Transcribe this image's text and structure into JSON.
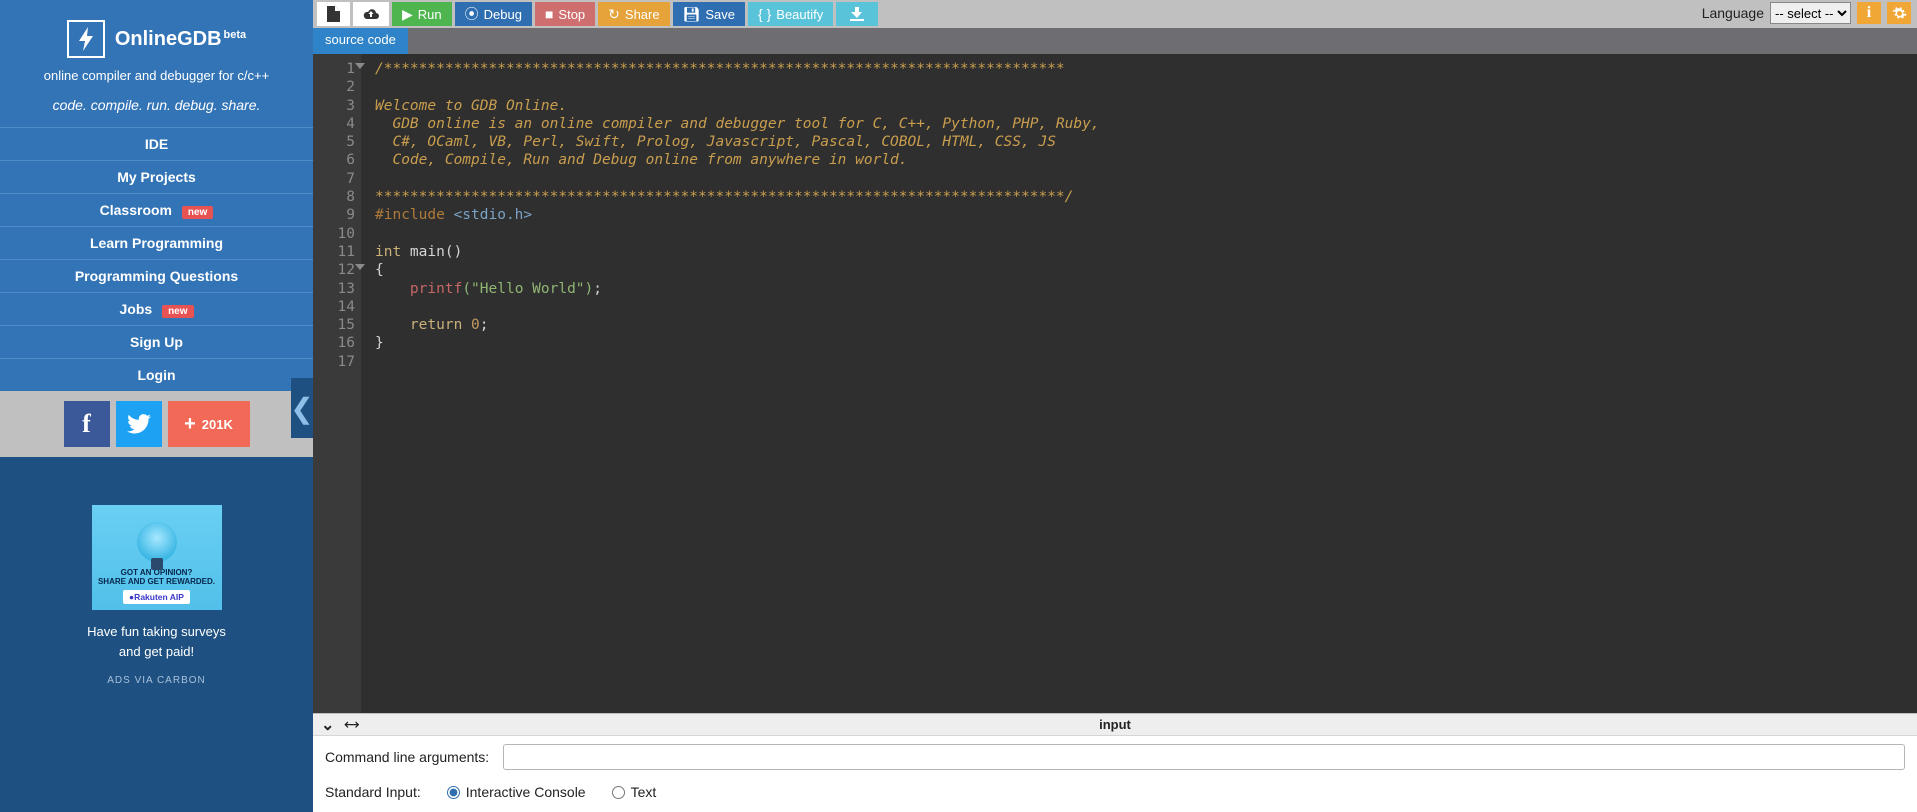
{
  "app": {
    "name": "OnlineGDB",
    "beta": "beta",
    "sub": "online compiler and debugger for c/c++",
    "tag": "code. compile. run. debug. share."
  },
  "nav": {
    "ide": "IDE",
    "projects": "My Projects",
    "classroom": "Classroom",
    "learn": "Learn Programming",
    "questions": "Programming Questions",
    "jobs": "Jobs",
    "signup": "Sign Up",
    "login": "Login",
    "new": "new"
  },
  "social": {
    "share_count": "201K"
  },
  "ad": {
    "line1": "GOT AN OPINION?",
    "line2": "SHARE AND GET REWARDED.",
    "strip": "●Rakuten AIP",
    "caption1": "Have fun taking surveys",
    "caption2": "and get paid!",
    "via": "ADS VIA CARBON"
  },
  "toolbar": {
    "run": "Run",
    "debug": "Debug",
    "stop": "Stop",
    "share": "Share",
    "save": "Save",
    "beautify": "Beautify",
    "language_label": "Language",
    "language_selected": "-- select --"
  },
  "tabs": {
    "source": "source code"
  },
  "code": {
    "lines": {
      "l1": "/******************************************************************************",
      "l2": "",
      "l3": "Welcome to GDB Online.",
      "l4": "  GDB online is an online compiler and debugger tool for C, C++, Python, PHP, Ruby, ",
      "l5": "  C#, OCaml, VB, Perl, Swift, Prolog, Javascript, Pascal, COBOL, HTML, CSS, JS",
      "l6": "  Code, Compile, Run and Debug online from anywhere in world.",
      "l7": "",
      "l8": "*******************************************************************************/",
      "include_kw": "#include ",
      "include_hdr": "<stdio.h>",
      "int": "int",
      "main_sig": " main()",
      "brace_open": "{",
      "printf": "printf",
      "printf_arg": "(\"Hello World\")",
      "semi": ";",
      "return_kw": "return",
      "zero": "0",
      "brace_close": "}"
    }
  },
  "bottom": {
    "title": "input",
    "cmd_label": "Command line arguments:",
    "stdin_label": "Standard Input:",
    "opt_interactive": "Interactive Console",
    "opt_text": "Text"
  }
}
